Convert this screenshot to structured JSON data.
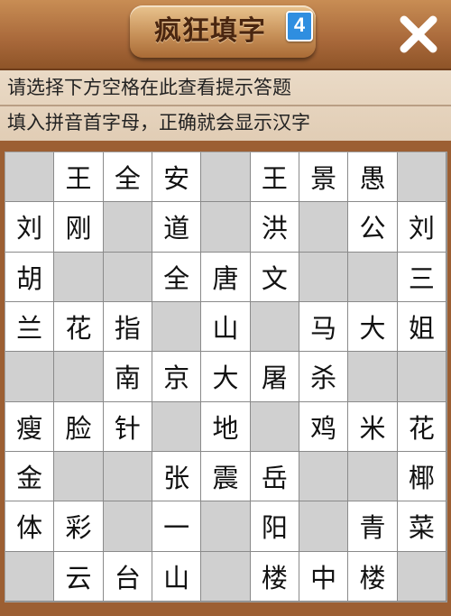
{
  "header": {
    "title": "疯狂填字",
    "level": "4",
    "close_icon": "close-x-icon"
  },
  "hints": {
    "line1": "请选择下方空格在此查看提示答题",
    "line2": "填入拼音首字母，正确就会显示汉字"
  },
  "board": {
    "rows": [
      [
        "",
        "王",
        "全",
        "安",
        "",
        "王",
        "景",
        "愚",
        ""
      ],
      [
        "刘",
        "刚",
        "",
        "道",
        "",
        "洪",
        "",
        "公",
        "刘"
      ],
      [
        "胡",
        "",
        "",
        "全",
        "唐",
        "文",
        "",
        "",
        "三"
      ],
      [
        "兰",
        "花",
        "指",
        "",
        "山",
        "",
        "马",
        "大",
        "姐"
      ],
      [
        "",
        "",
        "南",
        "京",
        "大",
        "屠",
        "杀",
        "",
        ""
      ],
      [
        "瘦",
        "脸",
        "针",
        "",
        "地",
        "",
        "鸡",
        "米",
        "花"
      ],
      [
        "金",
        "",
        "",
        "张",
        "震",
        "岳",
        "",
        "",
        "椰"
      ],
      [
        "体",
        "彩",
        "",
        "一",
        "",
        "阳",
        "",
        "青",
        "菜"
      ],
      [
        "",
        "云",
        "台",
        "山",
        "",
        "楼",
        "中",
        "楼",
        ""
      ]
    ]
  },
  "colors": {
    "blank_cell": "#d0d0d0",
    "filled_cell": "#ffffff",
    "level_badge": "#2f8ee0"
  }
}
